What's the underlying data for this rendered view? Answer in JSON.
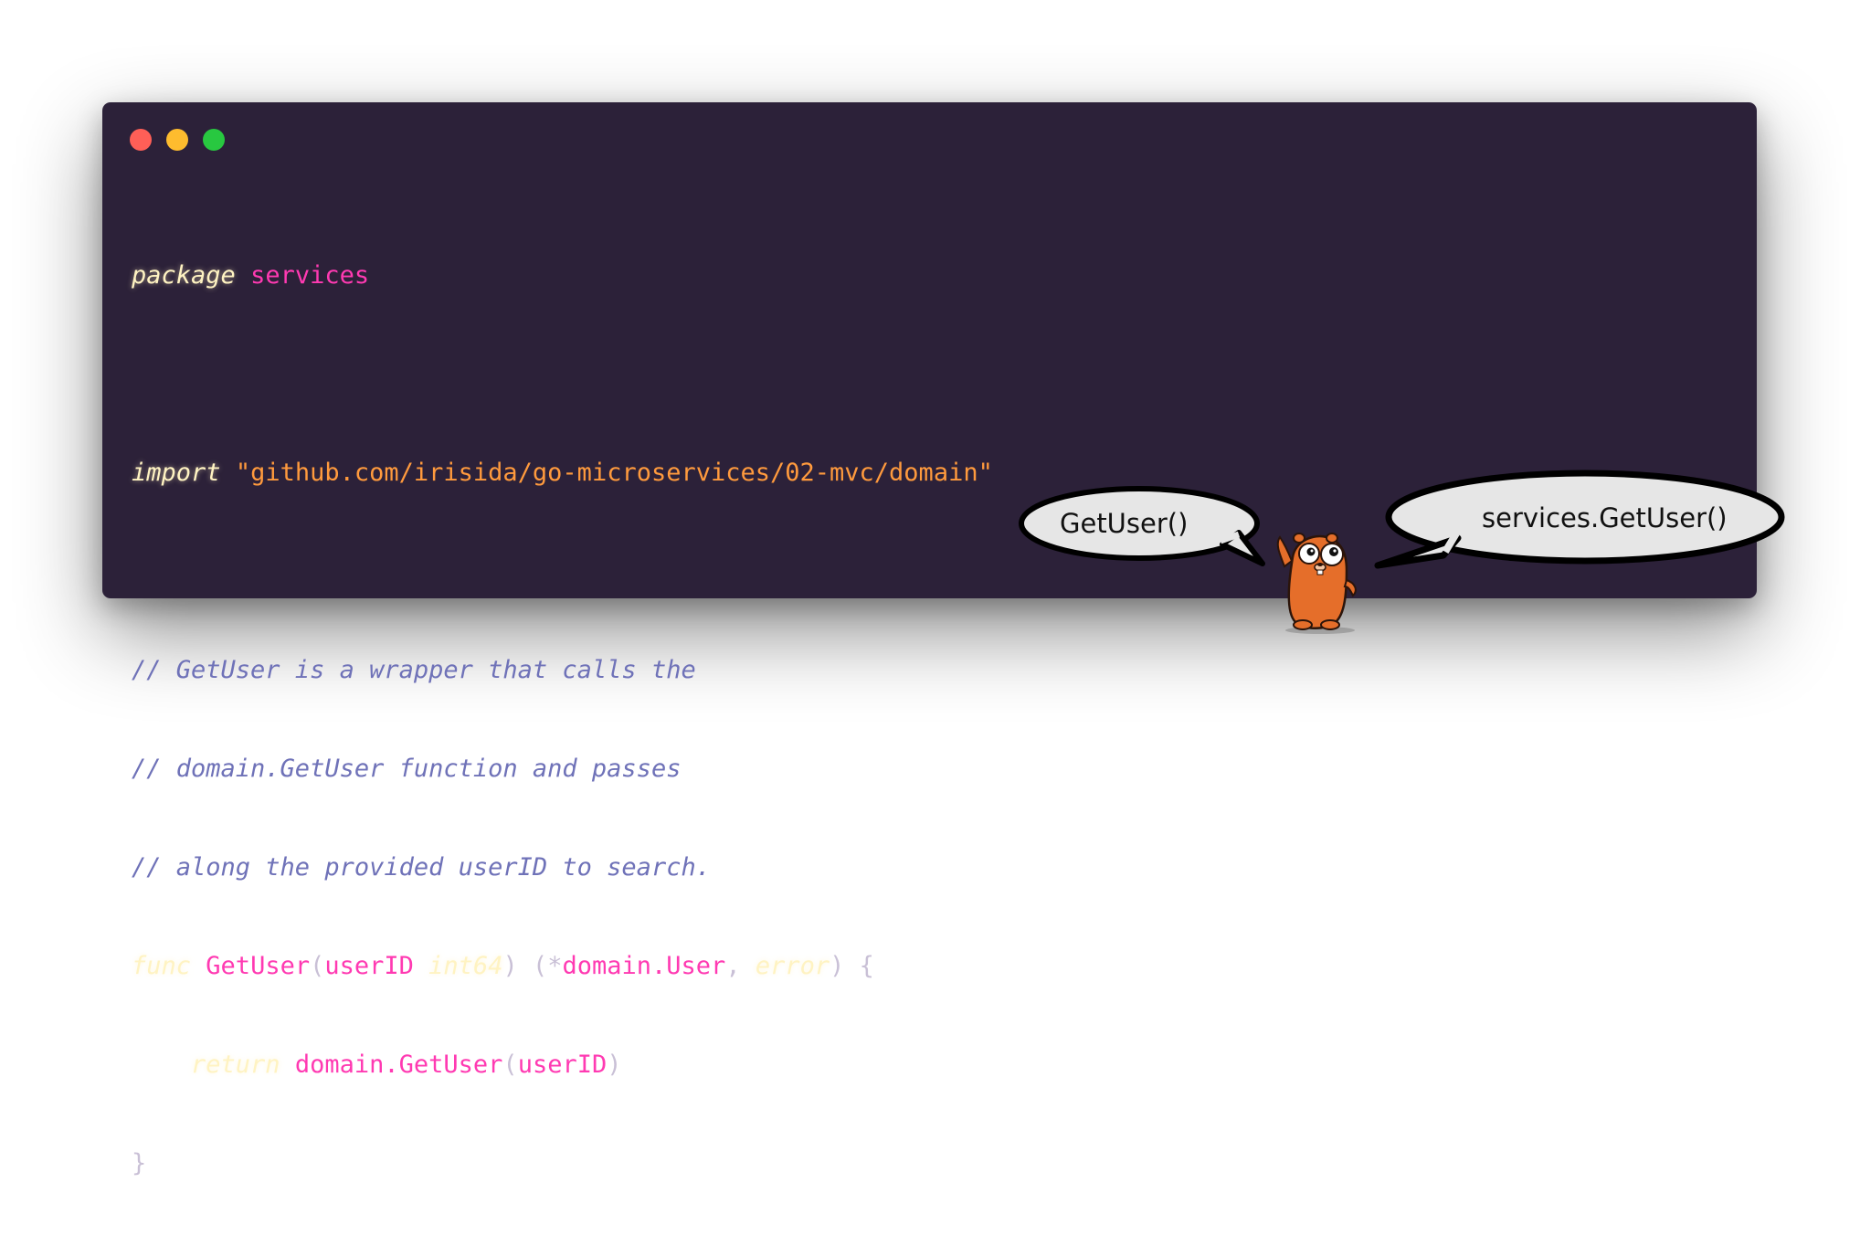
{
  "window": {
    "controls": [
      "close",
      "minimize",
      "zoom"
    ]
  },
  "code": {
    "line1": {
      "keyword": "package",
      "name": "services"
    },
    "line2": {
      "keyword": "import",
      "path": "\"github.com/irisida/go-microservices/02-mvc/domain\""
    },
    "comments": [
      "// GetUser is a wrapper that calls the",
      "// domain.GetUser function and passes",
      "// along the provided userID to search."
    ],
    "func_line": {
      "keyword": "func",
      "name": "GetUser",
      "open": "(",
      "param": "userID",
      "param_type": "int64",
      "close": ")",
      "ret_open": " (*",
      "ret_type": "domain.User",
      "comma": ", ",
      "ret_err": "error",
      "ret_close": ") {"
    },
    "return_line": {
      "keyword": "return",
      "call": "domain.GetUser",
      "open": "(",
      "arg": "userID",
      "close": ")"
    },
    "close_brace": "}"
  },
  "bubbles": {
    "left": "GetUser()",
    "right": "services.GetUser()"
  },
  "colors": {
    "background": "#2c2139",
    "keyword": "#fff3c2",
    "identifier": "#ff3ab2",
    "string": "#ff9a3d",
    "comment": "#6f72b8",
    "punctuation": "#c9c0d6",
    "gopher": "#e56e2a"
  },
  "icons": {
    "mascot": "gopher-icon"
  }
}
